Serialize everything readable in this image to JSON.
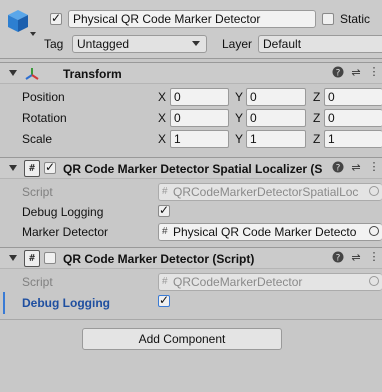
{
  "gameobject": {
    "name": "Physical QR Code Marker Detector",
    "active": true,
    "static_label": "Static",
    "tag_label": "Tag",
    "tag_value": "Untagged",
    "layer_label": "Layer",
    "layer_value": "Default"
  },
  "transform": {
    "title": "Transform",
    "rows": [
      {
        "label": "Position",
        "x": "0",
        "y": "0",
        "z": "0"
      },
      {
        "label": "Rotation",
        "x": "0",
        "y": "0",
        "z": "0"
      },
      {
        "label": "Scale",
        "x": "1",
        "y": "1",
        "z": "1"
      }
    ],
    "axis": {
      "x": "X",
      "y": "Y",
      "z": "Z"
    }
  },
  "spatial_localizer": {
    "title": "QR Code Marker Detector Spatial Localizer (S",
    "enabled": true,
    "script_label": "Script",
    "script_value": "QRCodeMarkerDetectorSpatialLoc",
    "debug_label": "Debug Logging",
    "debug_checked": true,
    "marker_label": "Marker Detector",
    "marker_value": "Physical QR Code Marker Detecto"
  },
  "detector": {
    "title": "QR Code Marker Detector (Script)",
    "enabled": false,
    "script_label": "Script",
    "script_value": "QRCodeMarkerDetector",
    "debug_label": "Debug Logging",
    "debug_checked": true
  },
  "add_component_label": "Add Component",
  "colors": {
    "background": "#c8c8c8",
    "selected_label": "#1f4fa0",
    "selected_bar": "#3a7bd5"
  }
}
